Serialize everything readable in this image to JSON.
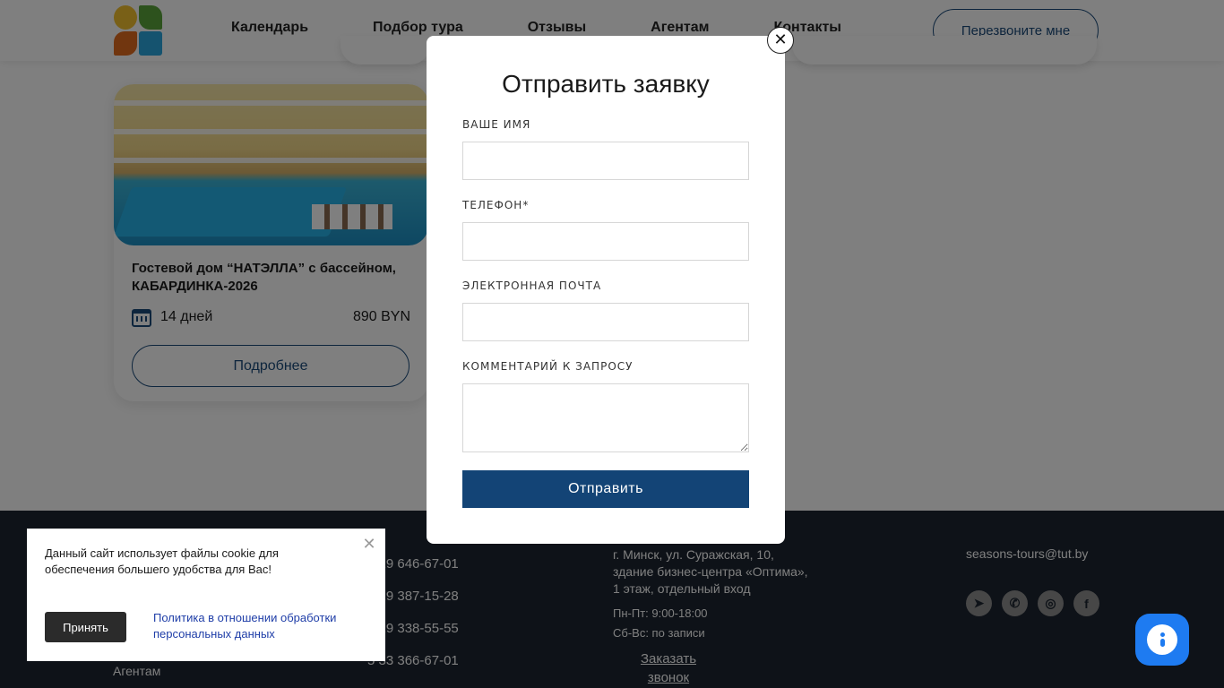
{
  "header": {
    "nav": [
      "Календарь",
      "Подбор тура",
      "Отзывы",
      "Агентам",
      "Контакты"
    ],
    "callback_label": "Перезвоните мне"
  },
  "card": {
    "title": "Гостевой дом “НАТЭЛЛА” с бассейном, КАБАРДИНКА-2026",
    "duration": "14 дней",
    "price": "890 BYN",
    "more_label": "Подробнее"
  },
  "footer": {
    "phones": [
      "5 29 646-67-01",
      "5 29 387-15-28",
      "5 29 338-55-55",
      "5 33 366-67-01"
    ],
    "address": [
      "г. Минск, ул. Суражская, 10,",
      "здание бизнес-центра «Оптима»,",
      "1 этаж, отдельный вход"
    ],
    "hours": [
      "Пн-Пт: 9:00-18:00",
      "Сб-Вс: по записи"
    ],
    "order_call": "Заказать звонок",
    "email": "seasons-tours@tut.by",
    "agents_link": "Агентам",
    "socials": [
      "telegram-icon",
      "viber-icon",
      "instagram-icon",
      "facebook-icon"
    ]
  },
  "modal": {
    "title": "Отправить заявку",
    "name_label": "ВАШЕ ИМЯ",
    "phone_label": "ТЕЛЕФОН*",
    "email_label": "ЭЛЕКТРОННАЯ ПОЧТА",
    "comment_label": "КОММЕНТАРИЙ К ЗАПРОСУ",
    "name_value": "",
    "phone_value": "",
    "email_value": "",
    "comment_value": "",
    "submit_label": "Отправить",
    "close_glyph": "✕"
  },
  "cookie": {
    "text": "Данный сайт использует файлы cookie для обеспечения большего удобства для Вас!",
    "accept_label": "Принять",
    "policy_link": "Политика в отношении обработки персональных данных",
    "close_glyph": "✕"
  },
  "colors": {
    "brand": "#134476",
    "overlay": "rgba(0,0,0,0.5)",
    "chat": "#1e7bf1",
    "footer_bg": "#1c2530"
  }
}
